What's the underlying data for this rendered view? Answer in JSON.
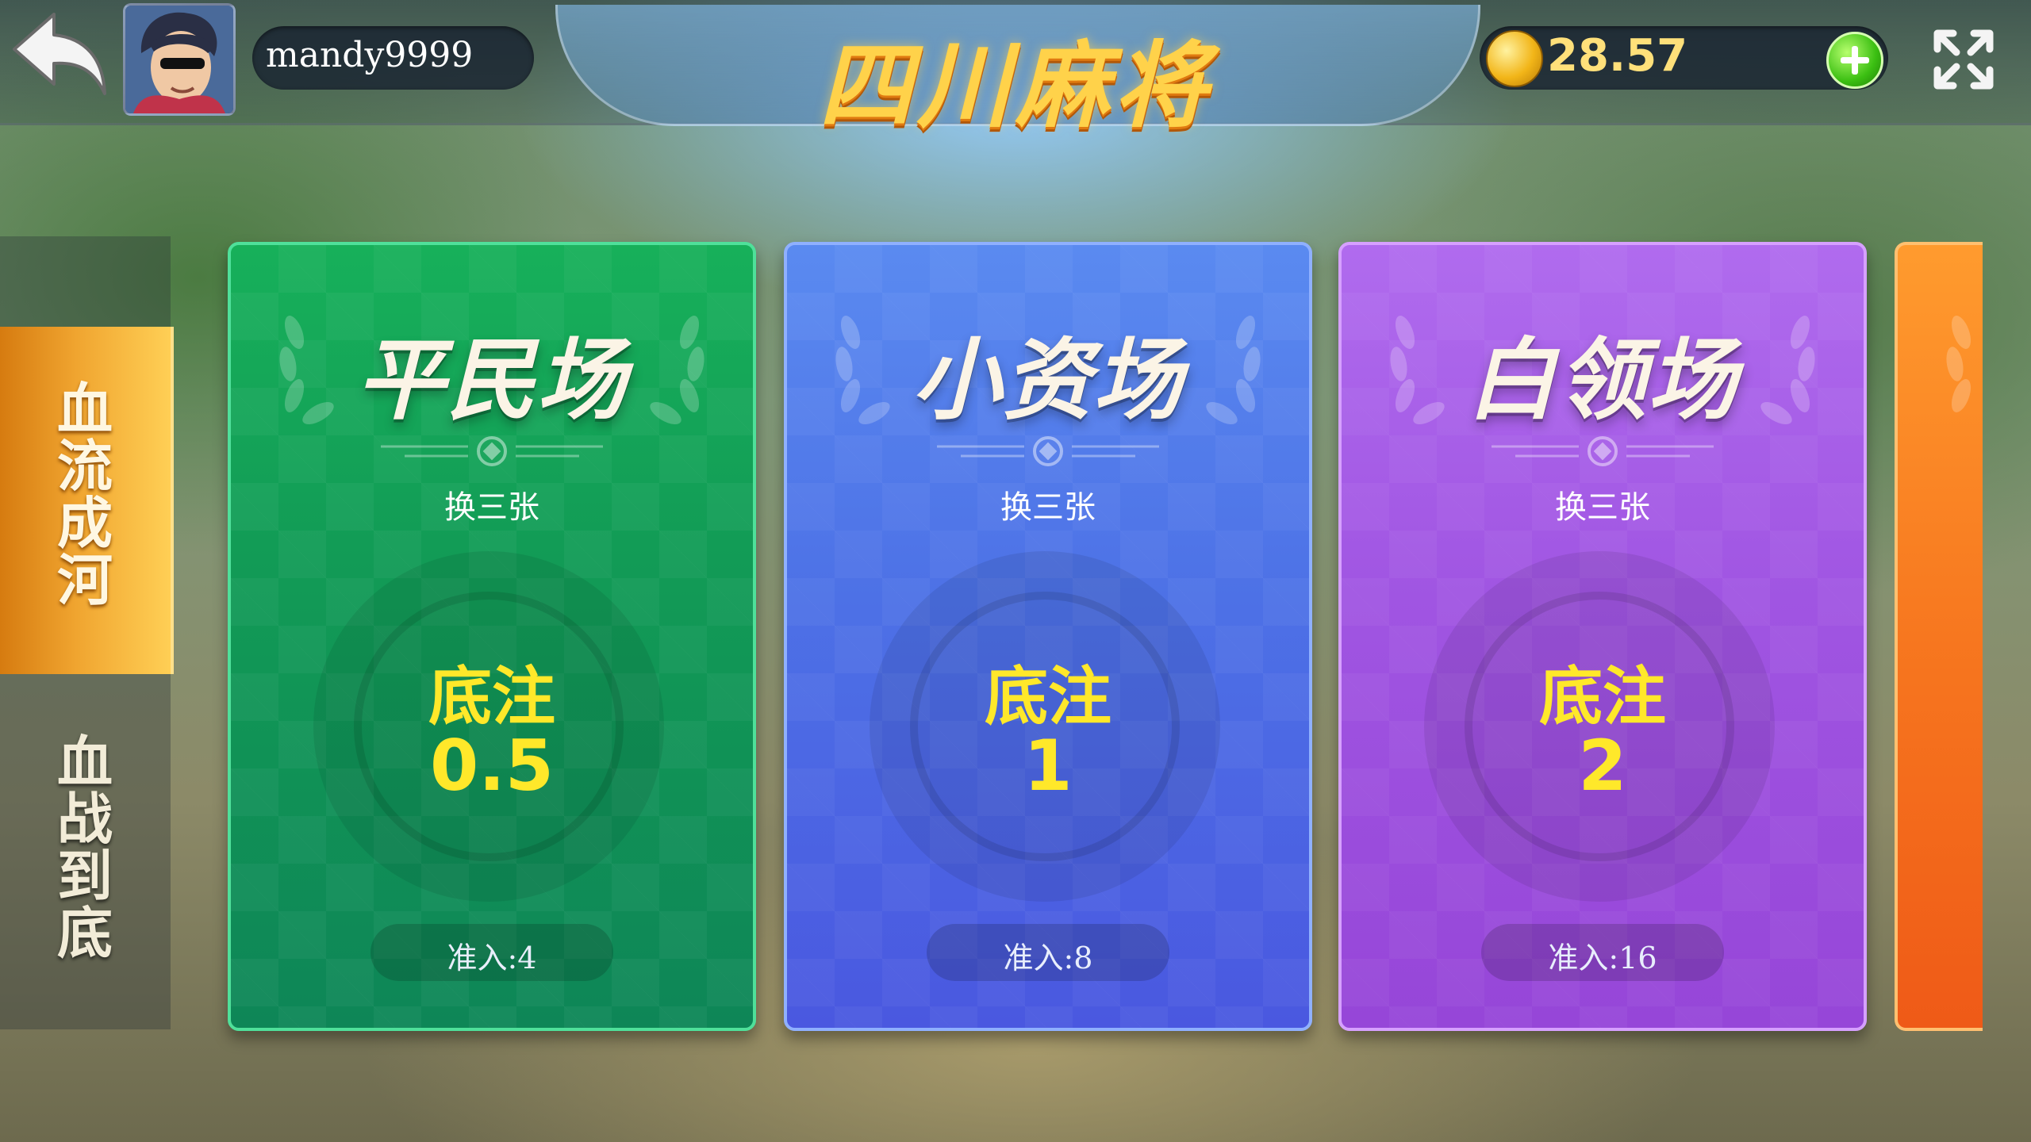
{
  "header": {
    "username": "mandy9999",
    "title": "四川麻将",
    "coins": "28.57"
  },
  "tabs": [
    {
      "label": "血流成河",
      "active": true
    },
    {
      "label": "血战到底",
      "active": false
    }
  ],
  "rooms": [
    {
      "name": "平民场",
      "mode": "换三张",
      "bet_label": "底注",
      "bet": "0.5",
      "entry": "准入:4",
      "color": "#17b05a"
    },
    {
      "name": "小资场",
      "mode": "换三张",
      "bet_label": "底注",
      "bet": "1",
      "entry": "准入:8",
      "color": "#4d71e6"
    },
    {
      "name": "白领场",
      "mode": "换三张",
      "bet_label": "底注",
      "bet": "2",
      "entry": "准入:16",
      "color": "#a055e2"
    }
  ],
  "icons": {
    "back": "back-arrow-icon",
    "coin": "coin-icon",
    "add": "plus-icon",
    "fullscreen": "fullscreen-icon"
  },
  "colors": {
    "title_gold": "#ffd24a",
    "bet_yellow": "#ffe82a",
    "tab_active": "#f0a530"
  }
}
